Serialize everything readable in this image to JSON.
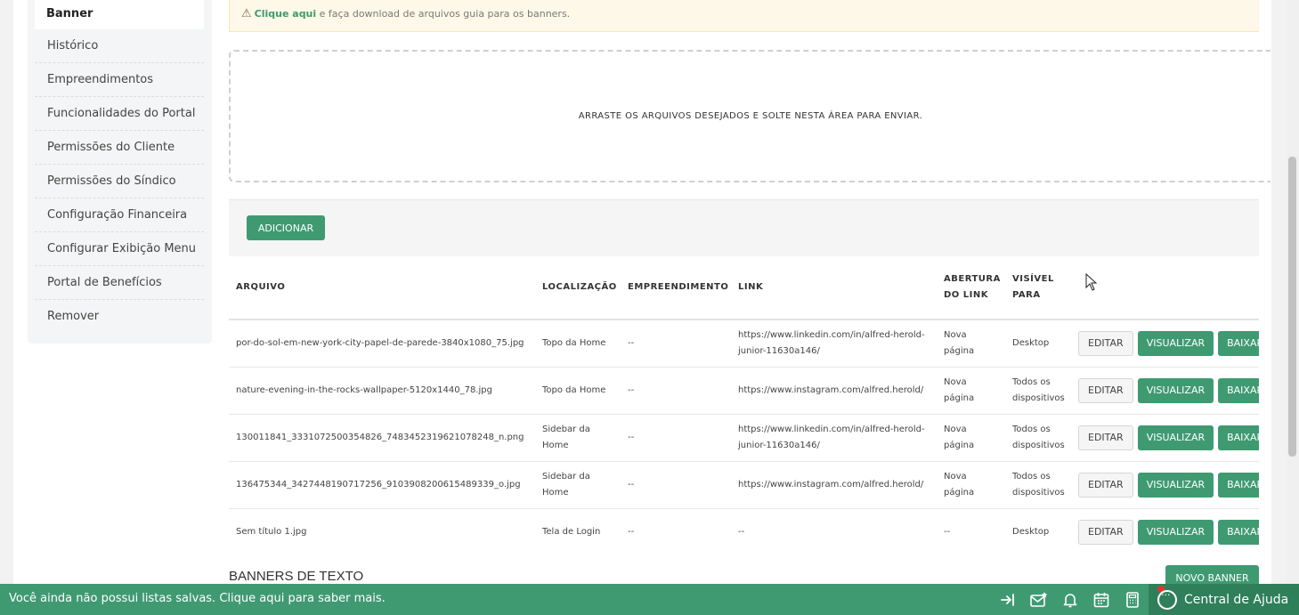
{
  "sidebar": {
    "active": "Banner",
    "items": [
      "Histórico",
      "Empreendimentos",
      "Funcionalidades do Portal",
      "Permissões do Cliente",
      "Permissões do Síndico",
      "Configuração Financeira",
      "Configurar Exibição Menu",
      "Portal de Benefícios",
      "Remover"
    ]
  },
  "notice": {
    "icon": "warning-icon",
    "link": "Clique aqui",
    "text": " e faça download de arquivos guia para os banners."
  },
  "dropzone": {
    "text": "ARRASTE OS ARQUIVOS DESEJADOS E SOLTE NESTA ÁREA PARA ENVIAR."
  },
  "toolbar": {
    "add_label": "ADICIONAR"
  },
  "table": {
    "headers": {
      "arquivo": "ARQUIVO",
      "localizacao": "LOCALIZAÇÃO",
      "empreendimento": "EMPREENDIMENTO",
      "link": "LINK",
      "abertura": "ABERTURA DO LINK",
      "visivel": "VISÍVEL PARA"
    },
    "actions": {
      "edit": "EDITAR",
      "view": "VISUALIZAR",
      "download": "BAIXAR"
    },
    "rows": [
      {
        "arquivo": "por-do-sol-em-new-york-city-papel-de-parede-3840x1080_75.jpg",
        "localizacao": "Topo da Home",
        "empreendimento": "--",
        "link": "https://www.linkedin.com/in/alfred-herold-junior-11630a146/",
        "abertura": "Nova página",
        "visivel": "Desktop"
      },
      {
        "arquivo": "nature-evening-in-the-rocks-wallpaper-5120x1440_78.jpg",
        "localizacao": "Topo da Home",
        "empreendimento": "--",
        "link": "https://www.instagram.com/alfred.herold/",
        "abertura": "Nova página",
        "visivel": "Todos os dispositivos"
      },
      {
        "arquivo": "130011841_3331072500354826_7483452319621078248_n.png",
        "localizacao": "Sidebar da Home",
        "empreendimento": "--",
        "link": "https://www.linkedin.com/in/alfred-herold-junior-11630a146/",
        "abertura": "Nova página",
        "visivel": "Todos os dispositivos"
      },
      {
        "arquivo": "136475344_3427448190717256_9103908200615489339_o.jpg",
        "localizacao": "Sidebar da Home",
        "empreendimento": "--",
        "link": "https://www.instagram.com/alfred.herold/",
        "abertura": "Nova página",
        "visivel": "Todos os dispositivos"
      },
      {
        "arquivo": "Sem título 1.jpg",
        "localizacao": "Tela de Login",
        "empreendimento": "--",
        "link": "--",
        "abertura": "--",
        "visivel": "Desktop"
      }
    ]
  },
  "section": {
    "title": "BANNERS DE TEXTO",
    "new_label": "NOVO BANNER"
  },
  "bottombar": {
    "message": "Você ainda não possui listas salvas. Clique aqui para saber mais.",
    "help_label": "Central de Ajuda",
    "icons": [
      "login-arrow-icon",
      "mail-star-icon",
      "bell-icon",
      "calendar-icon",
      "calculator-icon",
      "chat-icon"
    ]
  },
  "colors": {
    "primary": "#3f9a72",
    "help_bg": "#2f7f5b",
    "notice_bg": "#fdf8e7"
  }
}
